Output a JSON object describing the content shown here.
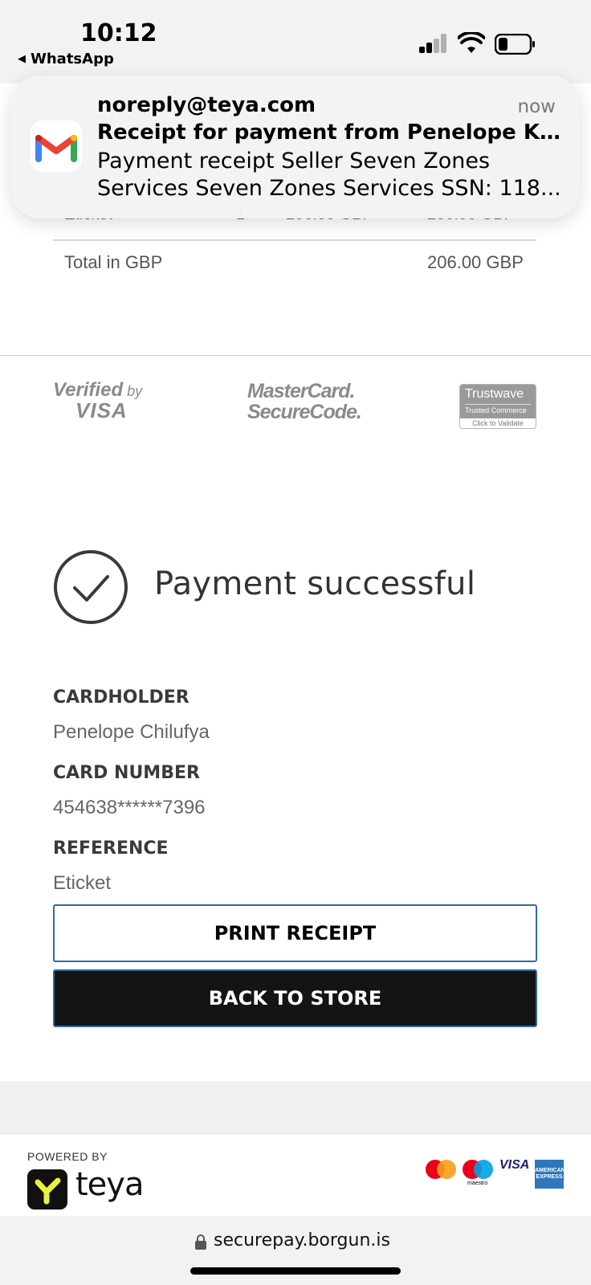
{
  "status_bar": {
    "time": "10:12",
    "back_app": "WhatsApp",
    "icons": [
      "cellular-signal-icon",
      "wifi-icon",
      "battery-icon"
    ]
  },
  "notification": {
    "app_icon": "gmail-icon",
    "sender": "noreply@teya.com",
    "time": "now",
    "subject": "Receipt for payment from Penelope Ka...",
    "body_line1": "Payment receipt Seller Seven Zones",
    "body_line2": "Services Seven Zones Services SSN: 118..."
  },
  "order": {
    "partial_row": {
      "item": "Eticket",
      "qty": "1",
      "unit_price": "206.00 GBP",
      "amount": "206.00 GBP"
    },
    "total_label": "Total in GBP",
    "total_value": "206.00 GBP"
  },
  "security_logos": {
    "verified_by": "Verified",
    "verified_by_small": "by",
    "visa": "VISA",
    "mastercard_line1": "MasterCard.",
    "mastercard_line2": "SecureCode.",
    "trustwave_name": "Trustwave",
    "trustwave_sub": "Trusted Commerce",
    "trustwave_cta": "Click to Validate"
  },
  "result": {
    "status": "Payment successful",
    "icon": "check-circle-icon"
  },
  "details": {
    "cardholder_label": "CARDHOLDER",
    "cardholder_value": "Penelope Chilufya",
    "card_number_label": "CARD NUMBER",
    "card_number_value": "454638******7396",
    "reference_label": "REFERENCE",
    "reference_value": "Eticket"
  },
  "actions": {
    "print_receipt": "PRINT RECEIPT",
    "back_to_store": "BACK TO STORE"
  },
  "footer": {
    "powered_by": "POWERED BY",
    "brand": "teya",
    "card_brands": [
      "mastercard-icon",
      "maestro-icon",
      "visa-icon",
      "amex-icon"
    ],
    "maestro_label": "maestro",
    "visa_label": "VISA",
    "amex_label": "AMERICAN EXPRESS"
  },
  "browser": {
    "url": "securepay.borgun.is"
  },
  "colors": {
    "button_dark": "#141414",
    "button_border": "#2f6aa7",
    "page_bg": "#ffffff",
    "chrome_bg": "#f2f2f2"
  }
}
